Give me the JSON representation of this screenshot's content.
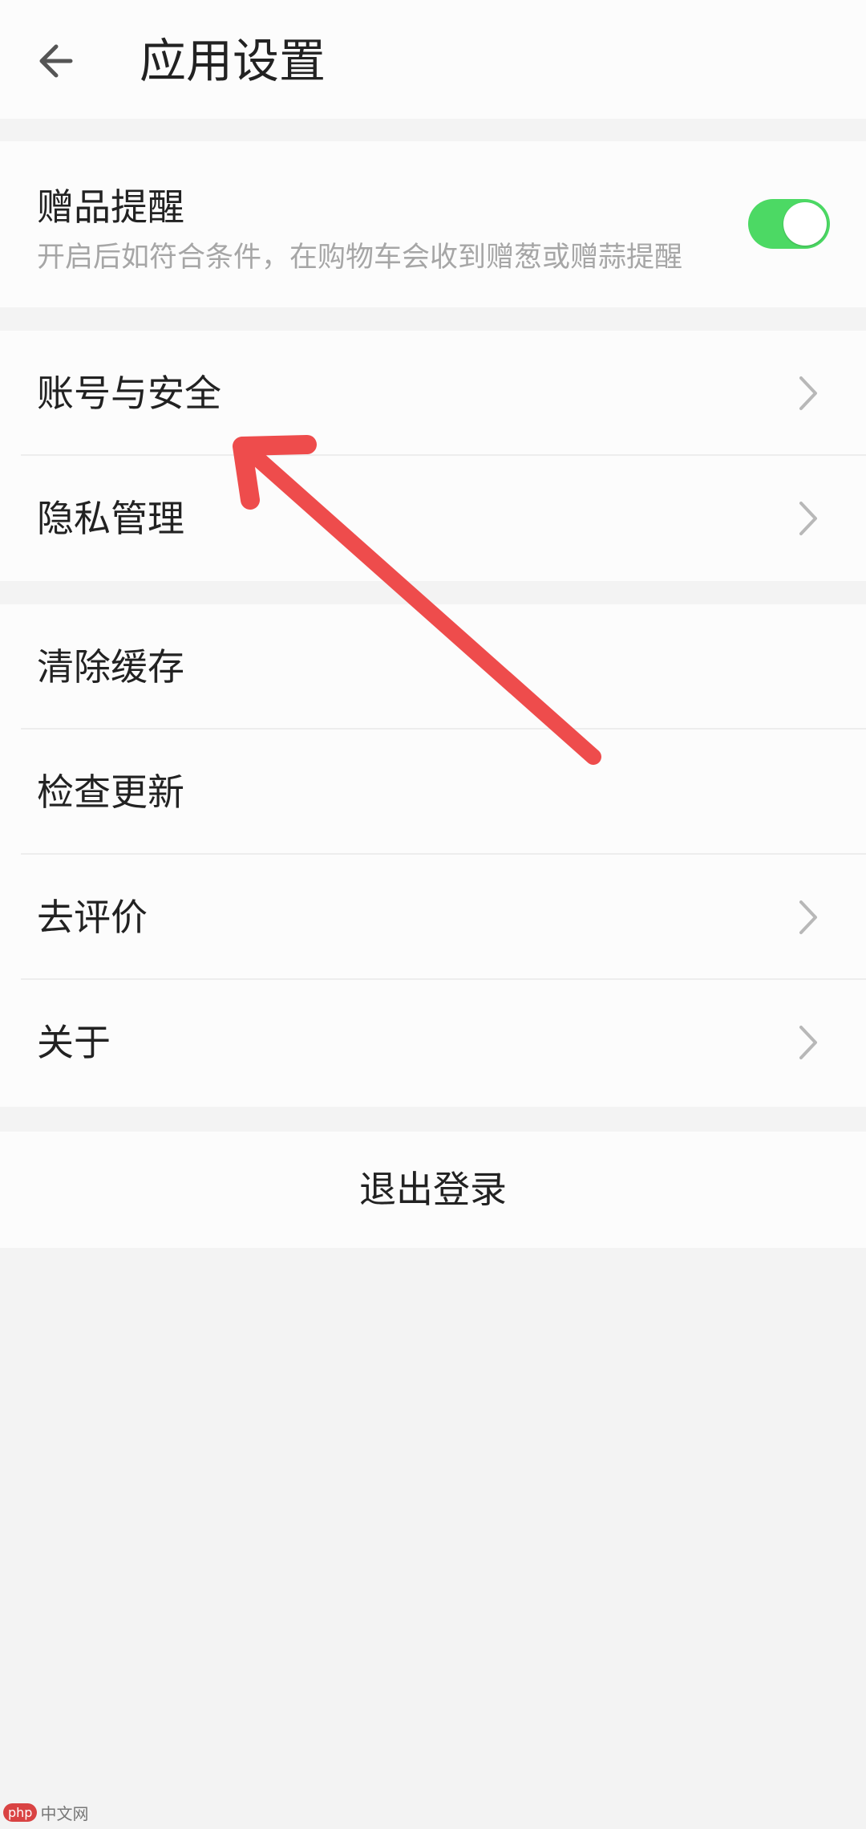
{
  "header": {
    "title": "应用设置",
    "back_icon": "arrow-left-icon"
  },
  "gift_reminder": {
    "title": "赠品提醒",
    "description": "开启后如符合条件，在购物车会收到赠葱或赠蒜提醒",
    "enabled": true,
    "toggle_color": "#4cd964"
  },
  "group_account": {
    "items": [
      {
        "label": "账号与安全",
        "icon": "chevron-right-icon"
      },
      {
        "label": "隐私管理",
        "icon": "chevron-right-icon"
      }
    ]
  },
  "group_general": {
    "items": [
      {
        "label": "清除缓存"
      },
      {
        "label": "检查更新"
      },
      {
        "label": "去评价",
        "icon": "chevron-right-icon"
      },
      {
        "label": "关于",
        "icon": "chevron-right-icon"
      }
    ]
  },
  "logout": {
    "label": "退出登录"
  },
  "annotation": {
    "icon": "red-arrow-annotation",
    "color": "#ee4c4c"
  },
  "watermark": {
    "badge": "php",
    "text": "中文网"
  }
}
